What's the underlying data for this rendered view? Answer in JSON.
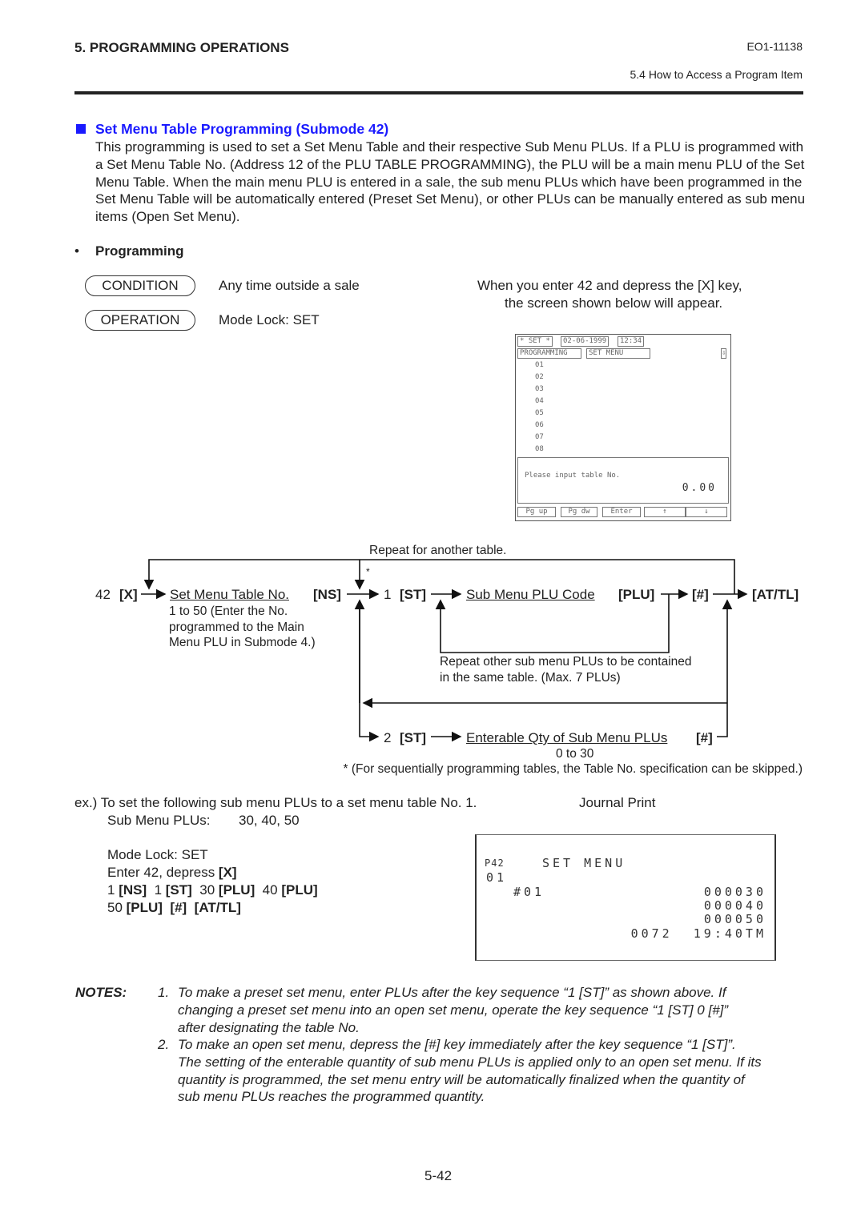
{
  "header": {
    "chapter": "5.  PROGRAMMING OPERATIONS",
    "doc_no": "EO1-11138",
    "section": "5.4  How to Access a Program Item"
  },
  "section_title": "Set Menu Table Programming (Submode 42)",
  "accent_color": "#1a1aff",
  "intro": "This programming is used to set a Set Menu Table and their respective Sub Menu PLUs. If a PLU is programmed with a Set Menu Table No. (Address 12 of the PLU TABLE PROGRAMMING), the PLU will be a main menu PLU of the Set Menu Table. When the main menu PLU is entered in a sale, the sub menu PLUs which have been programmed in the Set Menu Table will be automatically entered (Preset Set Menu), or other PLUs can be manually entered as sub menu items (Open Set Menu).",
  "programming_heading": "Programming",
  "condition": {
    "label": "CONDITION",
    "text": "Any time outside a sale"
  },
  "operation": {
    "label": "OPERATION",
    "text": "Mode Lock:  SET"
  },
  "screen_caption": [
    "When you enter 42 and depress the [X] key,",
    "the screen shown below will appear."
  ],
  "screen": {
    "mode": "* SET *",
    "date": "02-06-1999",
    "time": "12:34",
    "tab1": "PROGRAMMING",
    "tab2": "SET MENU",
    "scroll_icon": "⇩",
    "rows": [
      "01",
      "02",
      "03",
      "04",
      "05",
      "06",
      "07",
      "08"
    ],
    "prompt": "Please input table No.",
    "value": "0.00",
    "keys": [
      "Pg up",
      "Pg dw",
      "Enter",
      "↑",
      "↓"
    ]
  },
  "flow": {
    "repeat_table": "Repeat for another table.",
    "star": "*",
    "start": "42",
    "x_key": "[X]",
    "table_no": "Set Menu Table No.",
    "ns_key": "[NS]",
    "table_range": [
      "1 to 50 (Enter the No.",
      "programmed to the Main",
      "Menu PLU in Submode 4.)"
    ],
    "one": "1",
    "st_key": "[ST]",
    "plu_code": "Sub Menu PLU Code",
    "plu_key": "[PLU]",
    "hash_key": "[#]",
    "attl_key": "[AT/TL]",
    "repeat_plu": [
      "Repeat other sub menu PLUs to be contained",
      "in the same table. (Max. 7 PLUs)"
    ],
    "two": "2",
    "qty": "Enterable Qty of Sub Menu PLUs",
    "qty_range": "0 to 30",
    "footnote": "*  (For sequentially programming tables, the Table No. specification can be skipped.)"
  },
  "example": {
    "line1": "ex.)  To set the following sub menu PLUs to a set menu table No. 1.",
    "plus_label": "Sub Menu PLUs:",
    "plus_value": "30, 40, 50",
    "mode": "Mode Lock:  SET",
    "enter_a": "Enter 42, depress ",
    "enter_b": "[X]",
    ".": ".",
    "seq1": [
      "1 ",
      "[NS]",
      "  1 ",
      "[ST]",
      "  30 ",
      "[PLU]",
      "  40 ",
      "[PLU]"
    ],
    "seq2": [
      "50 ",
      "[PLU]",
      "  ",
      "[#]",
      "  ",
      "[AT/TL]"
    ],
    "journal_title": "Journal Print"
  },
  "journal": {
    "code": "P42",
    "title": "SET MENU",
    "table": "01",
    "num": "#01",
    "lines": [
      "000030",
      "000040",
      "000050"
    ],
    "footer": "0072  19:40TM"
  },
  "notes": {
    "label": "NOTES:",
    "n1": [
      "1.",
      "To make a preset set menu, enter PLUs after the key sequence “1 [ST]” as shown above. If",
      "changing a preset set menu into an open set menu, operate the key sequence “1 [ST]  0 [#]”",
      "after designating the table No."
    ],
    "n2": [
      "2.",
      "To make an open set menu, depress the [#] key immediately after the key sequence “1 [ST]”.",
      "The setting of the enterable quantity of sub menu PLUs is applied only to an open set menu. If its",
      "quantity is programmed, the set menu entry will be automatically finalized when the quantity of",
      "sub menu PLUs reaches the programmed quantity."
    ]
  },
  "page_number": "5-42"
}
